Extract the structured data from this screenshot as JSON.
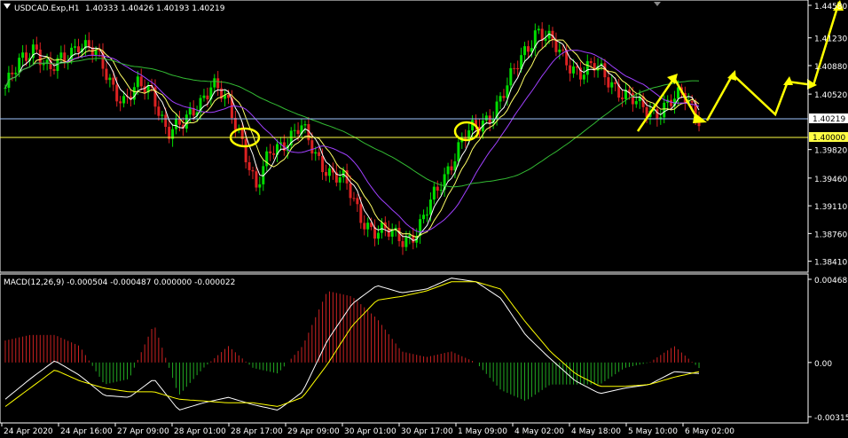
{
  "colors": {
    "background": "#000000",
    "axis": "#ffffff",
    "bull_candle": "#00dd00",
    "bear_candle": "#dd2222",
    "ma_fast": "#ffffff",
    "ma_mid": "#ffff66",
    "ma_slow": "#a040ff",
    "ma_long": "#33bb33",
    "hline": "#b8d8ff",
    "level_line": "#ffff44",
    "projection": "#ffff00",
    "macd_line": "#ffffff",
    "signal_line": "#ffff00",
    "hist_pos": "#cc2222",
    "hist_neg": "#22aa22"
  },
  "main_header": {
    "symbol": "USDCAD.Exp,H1",
    "ohlc": "1.40333 1.40426 1.40193 1.40219"
  },
  "macd_header": {
    "label": "MACD(12,26,9) -0.000504 -0.000487 0.000000 -0.000022"
  },
  "price_labels": {
    "current": "1.40219",
    "level": "1.40000",
    "level_box": "1.40000",
    "top_value": "1.44580"
  },
  "chart_data": [
    {
      "type": "candlestick",
      "title": "USDCAD.Exp,H1",
      "y_ticks": [
        "1.44580",
        "1.41230",
        "1.40880",
        "1.40520",
        "1.40219",
        "1.40000",
        "1.39820",
        "1.39460",
        "1.39110",
        "1.38760",
        "1.38410"
      ],
      "x_ticks": [
        "24 Apr 2020",
        "24 Apr 16:00",
        "27 Apr 09:00",
        "28 Apr 01:00",
        "28 Apr 17:00",
        "29 Apr 09:00",
        "30 Apr 01:00",
        "30 Apr 17:00",
        "1 May 09:00",
        "4 May 02:00",
        "4 May 18:00",
        "5 May 10:00",
        "6 May 02:00"
      ],
      "ylim": [
        1.3835,
        1.4154
      ],
      "close_path": [
        1.406,
        1.409,
        1.4115,
        1.408,
        1.4095,
        1.412,
        1.4105,
        1.407,
        1.4045,
        1.406,
        1.4055,
        1.4005,
        1.401,
        1.404,
        1.4065,
        1.404,
        1.4,
        1.393,
        1.398,
        1.3995,
        1.401,
        1.3975,
        1.3955,
        1.394,
        1.39,
        1.388,
        1.3875,
        1.387,
        1.388,
        1.392,
        1.396,
        1.3995,
        1.401,
        1.403,
        1.406,
        1.41,
        1.4135,
        1.4115,
        1.4095,
        1.408,
        1.4085,
        1.407,
        1.405,
        1.4035,
        1.403,
        1.404,
        1.405,
        1.4025
      ],
      "horizontal_levels": [
        1.40219,
        1.4
      ],
      "annotations": [
        "yellow circle near 28 Apr 17:00",
        "yellow circle near 1 May 09:00",
        "yellow zigzag projection after 6 May 02:00"
      ]
    },
    {
      "type": "line",
      "title": "MACD(12,26,9) -0.000504 -0.000487 0.000000 -0.000022",
      "y_ticks": [
        "0.00468",
        "0.00",
        "-0.00315"
      ],
      "ylim": [
        -0.00315,
        0.00468
      ],
      "series": [
        {
          "values": [
            -0.002,
            -0.0009,
            0.0001,
            -0.0007,
            -0.0018,
            -0.0019,
            -0.0009,
            -0.0026,
            -0.0022,
            -0.0019,
            -0.0023,
            -0.0026,
            -0.0016,
            0.0012,
            0.0032,
            0.0042,
            0.0038,
            0.004,
            0.0046,
            0.0044,
            0.0035,
            0.0015,
            0.0002,
            -0.001,
            -0.0017,
            -0.0014,
            -0.0012,
            -0.0005,
            -0.0006
          ]
        },
        {
          "values": [
            -0.0024,
            -0.0014,
            -0.0004,
            -0.001,
            -0.0014,
            -0.0016,
            -0.0016,
            -0.002,
            -0.0021,
            -0.0022,
            -0.0022,
            -0.0024,
            -0.0019,
            -0.0001,
            0.002,
            0.0034,
            0.0036,
            0.0039,
            0.0044,
            0.0044,
            0.004,
            0.0022,
            0.0006,
            -0.0006,
            -0.0013,
            -0.0013,
            -0.0012,
            -0.0008,
            -0.0005
          ]
        }
      ]
    }
  ]
}
